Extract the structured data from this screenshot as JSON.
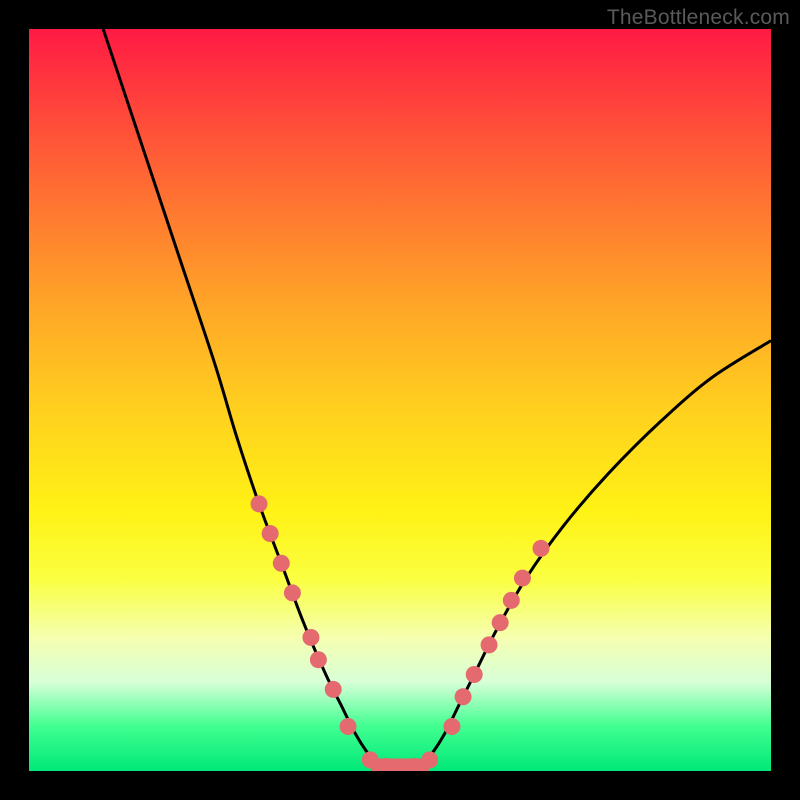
{
  "watermark": "TheBottleneck.com",
  "chart_data": {
    "type": "line",
    "title": "",
    "xlabel": "",
    "ylabel": "",
    "xlim": [
      0,
      100
    ],
    "ylim": [
      0,
      100
    ],
    "curve": {
      "name": "bottleneck-curve",
      "x": [
        10,
        15,
        20,
        25,
        28,
        31,
        34,
        37,
        40,
        42,
        44,
        46,
        48,
        50,
        52,
        54,
        56,
        58,
        60,
        63,
        67,
        72,
        78,
        85,
        92,
        100
      ],
      "y": [
        100,
        85,
        70,
        55,
        45,
        36,
        28,
        20,
        13,
        9,
        5,
        2,
        0.5,
        0,
        0.5,
        2,
        5,
        9,
        13,
        19,
        26,
        33,
        40,
        47,
        53,
        58
      ]
    },
    "markers": {
      "name": "highlight-points",
      "color": "#e46a6f",
      "points": [
        {
          "x": 31,
          "y": 36
        },
        {
          "x": 32.5,
          "y": 32
        },
        {
          "x": 34,
          "y": 28
        },
        {
          "x": 35.5,
          "y": 24
        },
        {
          "x": 38,
          "y": 18
        },
        {
          "x": 39,
          "y": 15
        },
        {
          "x": 41,
          "y": 11
        },
        {
          "x": 43,
          "y": 6
        },
        {
          "x": 46,
          "y": 1.5
        },
        {
          "x": 48,
          "y": 0.6
        },
        {
          "x": 50,
          "y": 0.5
        },
        {
          "x": 52,
          "y": 0.6
        },
        {
          "x": 54,
          "y": 1.5
        },
        {
          "x": 57,
          "y": 6
        },
        {
          "x": 58.5,
          "y": 10
        },
        {
          "x": 60,
          "y": 13
        },
        {
          "x": 62,
          "y": 17
        },
        {
          "x": 63.5,
          "y": 20
        },
        {
          "x": 65,
          "y": 23
        },
        {
          "x": 66.5,
          "y": 26
        },
        {
          "x": 69,
          "y": 30
        }
      ]
    }
  }
}
